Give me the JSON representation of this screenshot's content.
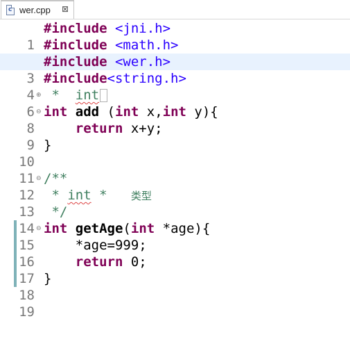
{
  "tab": {
    "label": "wer.cpp",
    "close": "⊠"
  },
  "lines": [
    {
      "n": "1",
      "fold": ""
    },
    {
      "n": "2",
      "fold": ""
    },
    {
      "n": "3",
      "fold": ""
    },
    {
      "n": "4",
      "fold": ""
    },
    {
      "n": "6",
      "fold": "⊕"
    },
    {
      "n": "8",
      "fold": "⊖"
    },
    {
      "n": "9",
      "fold": ""
    },
    {
      "n": "10",
      "fold": ""
    },
    {
      "n": "11",
      "fold": ""
    },
    {
      "n": "12",
      "fold": "⊖"
    },
    {
      "n": "13",
      "fold": ""
    },
    {
      "n": "14",
      "fold": ""
    },
    {
      "n": "15",
      "fold": "⊖"
    },
    {
      "n": "16",
      "fold": ""
    },
    {
      "n": "17",
      "fold": ""
    },
    {
      "n": "18",
      "fold": ""
    },
    {
      "n": "19",
      "fold": ""
    }
  ],
  "code": {
    "include_kw": "#include",
    "l1_hdr": "<jni.h>",
    "l2_hdr": "<math.h>",
    "l3_hdr": "<wer.h>",
    "l4_hdr": "<string.h>",
    "l6_prefix": " *  ",
    "l6_word": "int",
    "int_kw": "int",
    "l8_name": "add",
    "l8_open": " (",
    "l8_x": " x,",
    "l8_y": " y){",
    "return_kw": "return",
    "l9_expr": " x+y;",
    "brace_close": "}",
    "l12_text": "/**",
    "l13_prefix": " * ",
    "l13_word": "int",
    "l13_mid": " *   ",
    "l13_cjk": "类型",
    "l14_text": " */",
    "l15_name": "getAge",
    "l15_open": "(",
    "l15_arg": " *age){",
    "l16_text": "    *age=999;",
    "l17_expr": " 0;",
    "indent": "    "
  },
  "colors": {
    "keyword": "#7f0055",
    "string": "#2a00ff",
    "comment": "#3f7f5f",
    "highlight": "#e8f2fe",
    "marker": "#7fb2b8"
  }
}
